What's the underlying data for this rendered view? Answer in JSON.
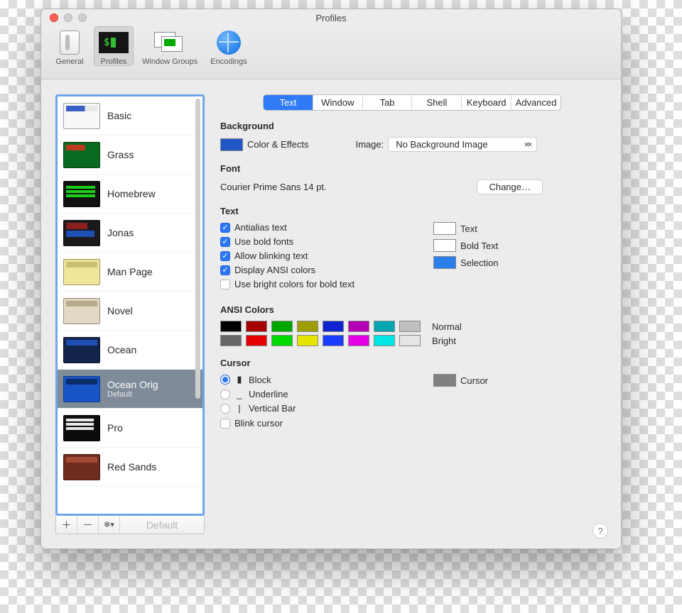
{
  "window": {
    "title": "Profiles"
  },
  "toolbar": {
    "items": [
      {
        "label": "General"
      },
      {
        "label": "Profiles"
      },
      {
        "label": "Window Groups"
      },
      {
        "label": "Encodings"
      }
    ],
    "selected": "Profiles"
  },
  "sidebar": {
    "profiles": [
      {
        "name": "Basic",
        "thumbClass": "th-basic"
      },
      {
        "name": "Grass",
        "thumbClass": "th-grass"
      },
      {
        "name": "Homebrew",
        "thumbClass": "th-home"
      },
      {
        "name": "Jonas",
        "thumbClass": "th-jonas"
      },
      {
        "name": "Man Page",
        "thumbClass": "th-man"
      },
      {
        "name": "Novel",
        "thumbClass": "th-novel"
      },
      {
        "name": "Ocean",
        "thumbClass": "th-ocean"
      },
      {
        "name": "Ocean Orig",
        "thumbClass": "th-oorig",
        "default": true,
        "selected": true,
        "subLabel": "Default"
      },
      {
        "name": "Pro",
        "thumbClass": "th-pro"
      },
      {
        "name": "Red Sands",
        "thumbClass": "th-red"
      }
    ],
    "defaultButton": "Default"
  },
  "tabs": {
    "items": [
      "Text",
      "Window",
      "Tab",
      "Shell",
      "Keyboard",
      "Advanced"
    ],
    "selected": "Text"
  },
  "background": {
    "heading": "Background",
    "colorEffectsLabel": "Color & Effects",
    "color": "#1f57c6",
    "imageLabel": "Image:",
    "imagePopup": "No Background Image"
  },
  "font": {
    "heading": "Font",
    "value": "Courier Prime Sans 14 pt.",
    "changeButton": "Change…"
  },
  "text": {
    "heading": "Text",
    "options": [
      {
        "label": "Antialias text",
        "checked": true
      },
      {
        "label": "Use bold fonts",
        "checked": true
      },
      {
        "label": "Allow blinking text",
        "checked": true
      },
      {
        "label": "Display ANSI colors",
        "checked": true
      },
      {
        "label": "Use bright colors for bold text",
        "checked": false
      }
    ],
    "swatches": [
      {
        "label": "Text",
        "color": "#ffffff"
      },
      {
        "label": "Bold Text",
        "color": "#ffffff"
      },
      {
        "label": "Selection",
        "color": "#2a7fe8"
      }
    ]
  },
  "ansi": {
    "heading": "ANSI Colors",
    "rows": [
      {
        "label": "Normal",
        "colors": [
          "#000000",
          "#a60000",
          "#00a600",
          "#9e9e00",
          "#0e24cf",
          "#b200b2",
          "#00a6b2",
          "#bfbfbf"
        ]
      },
      {
        "label": "Bright",
        "colors": [
          "#666666",
          "#e50000",
          "#00d900",
          "#e5e500",
          "#1a3cff",
          "#e500e5",
          "#00e5e5",
          "#e5e5e5"
        ]
      }
    ]
  },
  "cursor": {
    "heading": "Cursor",
    "shapes": [
      {
        "label": "Block",
        "glyph": "▮",
        "selected": true
      },
      {
        "label": "Underline",
        "glyph": "_"
      },
      {
        "label": "Vertical Bar",
        "glyph": "|"
      }
    ],
    "blink": {
      "label": "Blink cursor",
      "checked": false
    },
    "swatch": {
      "label": "Cursor",
      "color": "#808080"
    }
  },
  "help": "?"
}
